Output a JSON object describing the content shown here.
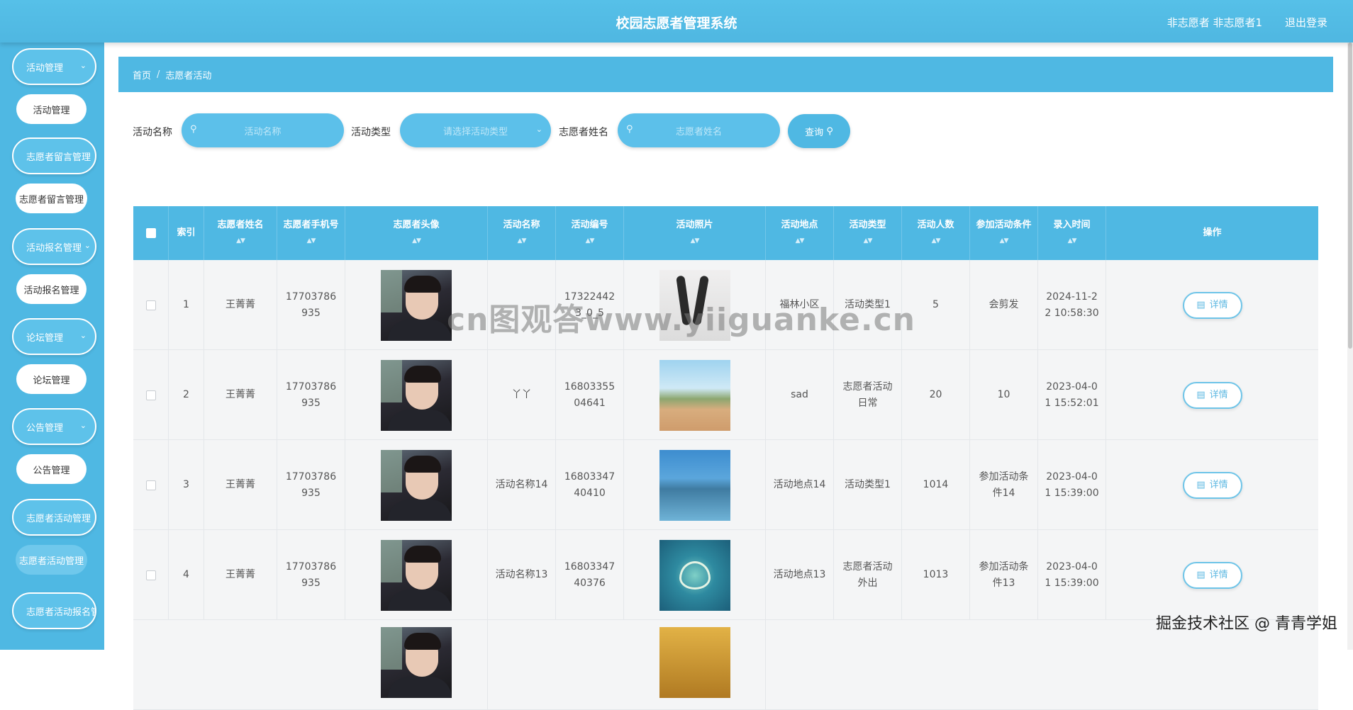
{
  "header": {
    "title": "校园志愿者管理系统",
    "user": "非志愿者 非志愿者1",
    "logout": "退出登录"
  },
  "sidebar": {
    "groups": [
      {
        "label": "活动管理",
        "sub": "活动管理"
      },
      {
        "label": "志愿者留言管理",
        "sub": "志愿者留言管理"
      },
      {
        "label": "活动报名管理",
        "sub": "活动报名管理"
      },
      {
        "label": "论坛管理",
        "sub": "论坛管理"
      },
      {
        "label": "公告管理",
        "sub": "公告管理"
      },
      {
        "label": "志愿者活动管理",
        "sub": "志愿者活动管理"
      },
      {
        "label": "志愿者活动报名管"
      }
    ]
  },
  "breadcrumb": {
    "home": "首页",
    "separator": "/",
    "current": "志愿者活动"
  },
  "search": {
    "activity_name_label": "活动名称",
    "activity_name_placeholder": "活动名称",
    "activity_type_label": "活动类型",
    "activity_type_placeholder": "请选择活动类型",
    "volunteer_name_label": "志愿者姓名",
    "volunteer_name_placeholder": "志愿者姓名",
    "query_label": "查询"
  },
  "table": {
    "headers": [
      "索引",
      "志愿者姓名",
      "志愿者手机号",
      "志愿者头像",
      "活动名称",
      "活动编号",
      "活动照片",
      "活动地点",
      "活动类型",
      "活动人数",
      "参加活动条件",
      "录入时间",
      "操作"
    ],
    "rows": [
      {
        "index": "1",
        "name": "王菁菁",
        "phone": "17703786935",
        "activity": "",
        "code": "173224423_0_5",
        "place": "福林小区",
        "type": "活动类型1",
        "count": "5",
        "cond": "会剪发",
        "time": "2024-11-22 10:58:30",
        "action": "详情"
      },
      {
        "index": "2",
        "name": "王菁菁",
        "phone": "17703786935",
        "activity": "丫丫",
        "code": "1680335504641",
        "place": "sad",
        "type": "志愿者活动日常",
        "count": "20",
        "cond": "10",
        "time": "2023-04-01 15:52:01",
        "action": "详情"
      },
      {
        "index": "3",
        "name": "王菁菁",
        "phone": "17703786935",
        "activity": "活动名称14",
        "code": "1680334740410",
        "place": "活动地点14",
        "type": "活动类型1",
        "count": "1014",
        "cond": "参加活动条件14",
        "time": "2023-04-01 15:39:00",
        "action": "详情"
      },
      {
        "index": "4",
        "name": "王菁菁",
        "phone": "17703786935",
        "activity": "活动名称13",
        "code": "1680334740376",
        "place": "活动地点13",
        "type": "志愿者活动外出",
        "count": "1013",
        "cond": "参加活动条件13",
        "time": "2023-04-01 15:39:00",
        "action": "详情"
      }
    ]
  },
  "watermark": "cn图观答www.yiiguanke.cn",
  "footer_mark": "掘金技术社区 @ 青青学姐"
}
